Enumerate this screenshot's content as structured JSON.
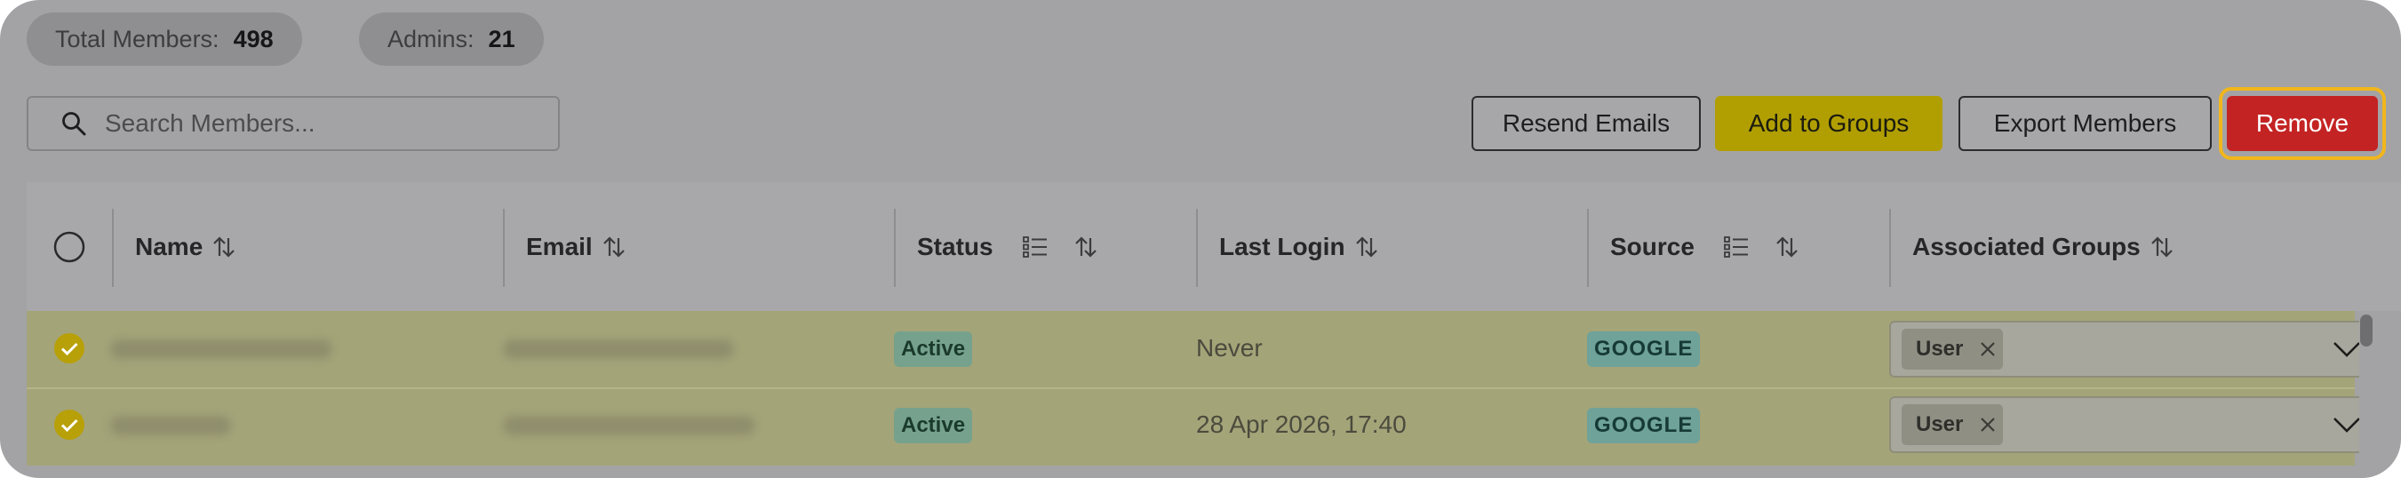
{
  "stats": {
    "total_label": "Total Members:",
    "total_value": "498",
    "admins_label": "Admins:",
    "admins_value": "21"
  },
  "search": {
    "placeholder": "Search Members...",
    "value": ""
  },
  "toolbar": {
    "resend": "Resend Emails",
    "add_groups": "Add to Groups",
    "export": "Export Members",
    "remove": "Remove"
  },
  "table": {
    "headers": {
      "name": "Name",
      "email": "Email",
      "status": "Status",
      "last_login": "Last Login",
      "source": "Source",
      "groups": "Associated Groups"
    },
    "rows": [
      {
        "selected": true,
        "status": "Active",
        "last_login": "Never",
        "source": "GOOGLE",
        "group": "User"
      },
      {
        "selected": true,
        "status": "Active",
        "last_login": "28 Apr 2026, 17:40",
        "source": "GOOGLE",
        "group": "User"
      }
    ]
  },
  "colors": {
    "overlay": "#a3a3a5",
    "accent_yellow": "#b19f02",
    "remove_red": "#c42323",
    "focus_ring": "#f1b61b",
    "selected_row": "#a4a479"
  },
  "icons": {
    "search": "search-icon",
    "sort": "sort-arrows-icon",
    "filter": "filter-list-icon",
    "check": "checkmark-circle-icon",
    "remove_chip": "close-icon",
    "dropdown": "chevron-down-icon"
  }
}
